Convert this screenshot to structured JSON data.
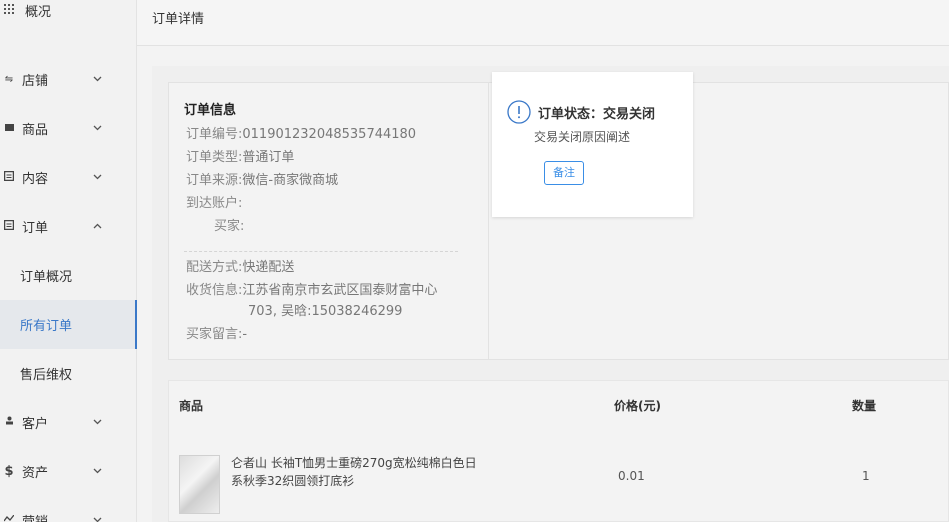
{
  "sidebar": {
    "items": [
      {
        "label": "概况",
        "icon": "grid-icon"
      },
      {
        "label": "店铺",
        "icon": "store-icon"
      },
      {
        "label": "商品",
        "icon": "goods-icon"
      },
      {
        "label": "内容",
        "icon": "content-icon"
      },
      {
        "label": "订单",
        "icon": "order-icon"
      },
      {
        "label": "客户",
        "icon": "customer-icon"
      },
      {
        "label": "资产",
        "icon": "dollar-icon"
      },
      {
        "label": "营销",
        "icon": "marketing-icon"
      }
    ],
    "order_submenu": [
      "订单概况",
      "所有订单",
      "售后维权"
    ],
    "active_submenu": "所有订单"
  },
  "header": {
    "title": "订单详情"
  },
  "order_info": {
    "title": "订单信息",
    "order_no_label": "订单编号:",
    "order_no": "011901232048535744180",
    "order_type_label": "订单类型:",
    "order_type": "普通订单",
    "order_source_label": "订单来源:",
    "order_source": "微信-商家微商城",
    "account_label": "到达账户:",
    "buyer_label": "买家:",
    "delivery_label": "配送方式:",
    "delivery": "快递配送",
    "address_label": "收货信息:",
    "address_line1": "江苏省南京市玄武区国泰财富中心",
    "address_line2": "703, 吴晗:15038246299",
    "message_label": "买家留言:",
    "message": "-"
  },
  "status": {
    "title": "订单状态：交易关闭",
    "reason": "交易关闭原因阐述",
    "remark_button": "备注"
  },
  "product_table": {
    "columns": [
      "商品",
      "价格(元)",
      "数量"
    ],
    "rows": [
      {
        "name": "仑者山 长袖T恤男士重磅270g宽松纯棉白色日系秋季32织圆领打底衫",
        "price": "0.01",
        "quantity": "1"
      }
    ]
  },
  "colors": {
    "accent": "#3a78c8",
    "button": "#3a8ee6"
  }
}
